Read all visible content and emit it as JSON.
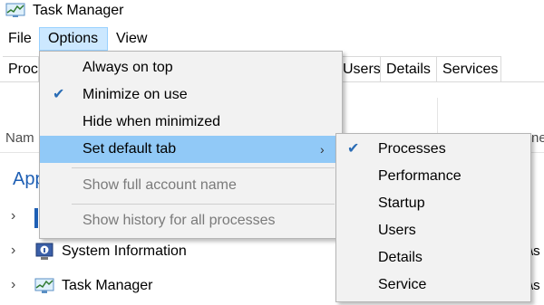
{
  "window": {
    "title": "Task Manager",
    "icon": "task-manager-icon"
  },
  "menubar": {
    "items": [
      "File",
      "Options",
      "View"
    ]
  },
  "tabs": {
    "visible": [
      "Proc",
      "Users",
      "Details",
      "Services"
    ]
  },
  "columns": {
    "name": "Nam",
    "right": "ne"
  },
  "apps": {
    "heading": "App",
    "rows": [
      {
        "label": "",
        "icon": "app-icon-blue",
        "right": ""
      },
      {
        "label": "System Information",
        "icon": "system-information-icon",
        "right": "\\s"
      },
      {
        "label": "Task Manager",
        "icon": "task-manager-icon",
        "right": "\\s"
      }
    ]
  },
  "options_menu": {
    "items": [
      {
        "label": "Always on top",
        "checked": false,
        "disabled": false
      },
      {
        "label": "Minimize on use",
        "checked": true,
        "disabled": false
      },
      {
        "label": "Hide when minimized",
        "checked": false,
        "disabled": false
      },
      {
        "label": "Set default tab",
        "checked": false,
        "disabled": false,
        "submenu": true,
        "highlighted": true
      },
      {
        "label": "Show full account name",
        "checked": false,
        "disabled": true
      },
      {
        "label": "Show history for all processes",
        "checked": false,
        "disabled": true
      }
    ],
    "arrow": "›",
    "check": "✔"
  },
  "default_tab_submenu": {
    "items": [
      {
        "label": "Processes",
        "checked": true
      },
      {
        "label": "Performance",
        "checked": false
      },
      {
        "label": "Startup",
        "checked": false
      },
      {
        "label": "Users",
        "checked": false
      },
      {
        "label": "Details",
        "checked": false
      },
      {
        "label": "Service",
        "checked": false
      }
    ],
    "check": "✔"
  },
  "colors": {
    "accent": "#1e5fb4",
    "menu_highlight": "#91c9f7",
    "menu_bg": "#f2f2f2"
  }
}
